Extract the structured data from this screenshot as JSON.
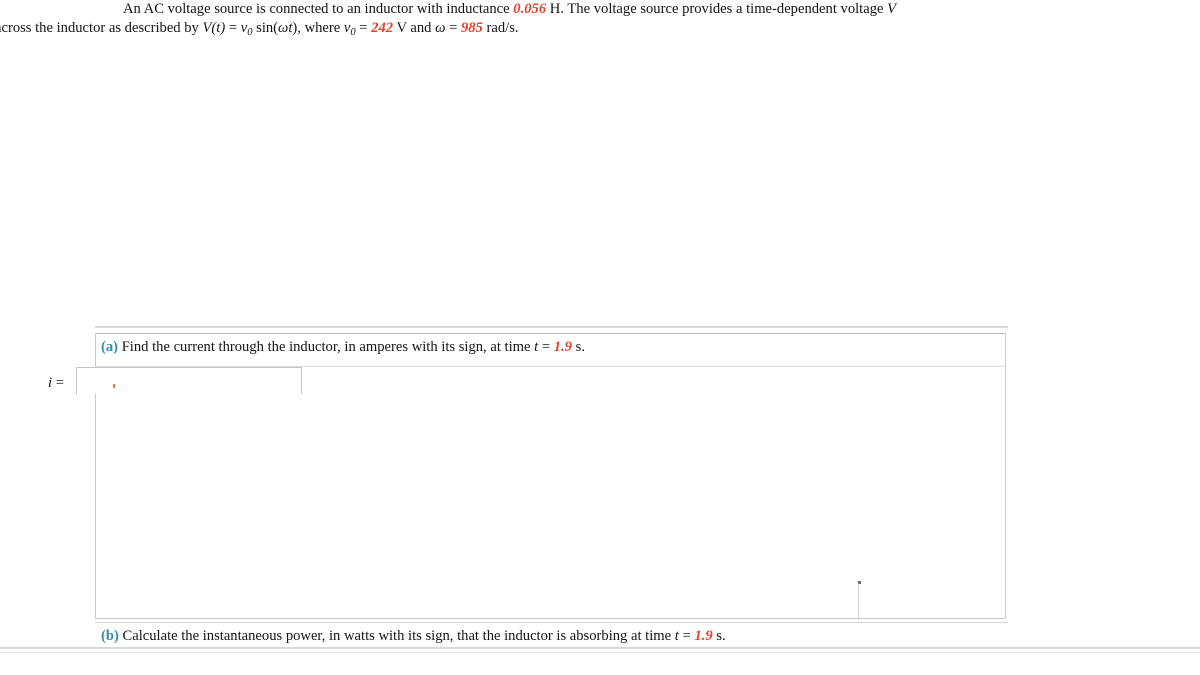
{
  "problem": {
    "line1_lead": "An AC voltage source is connected to an inductor with inductance",
    "inductance_value": "0.056",
    "inductance_unit": "H.",
    "line1_tail": "The voltage source provides a time-dependent voltage",
    "voltage_symbol": "V",
    "line2_lead": "across the inductor as described by",
    "equation": "V(t) = v0 sin(ωt), where",
    "v0_label": "v",
    "v0_sub": "0",
    "equals": "=",
    "v0_value": "242",
    "v0_unit": "V and",
    "omega_symbol": "ω",
    "omega_value": "985",
    "omega_unit": "rad/s."
  },
  "part_a": {
    "label": "(a)",
    "text_before_t": "Find the current through the inductor, in amperes with its sign, at time",
    "t_symbol": "t",
    "t_equals": "=",
    "t_value": "1.9",
    "t_unit": "s.",
    "answer_label": "i",
    "answer_equals": "=",
    "answer_value": "",
    "answer_placeholder": ""
  },
  "part_b": {
    "label": "(b)",
    "text_before_t": "Calculate the instantaneous power, in watts with its sign, that the inductor is absorbing at time",
    "t_symbol": "t",
    "t_equals": "=",
    "t_value": "1.9",
    "t_unit": "s."
  },
  "colors": {
    "value_red": "#e8412a",
    "part_label_teal": "#3b8ca8",
    "rule_gray": "#d6d8da",
    "caret_orange": "#f07a3c"
  }
}
